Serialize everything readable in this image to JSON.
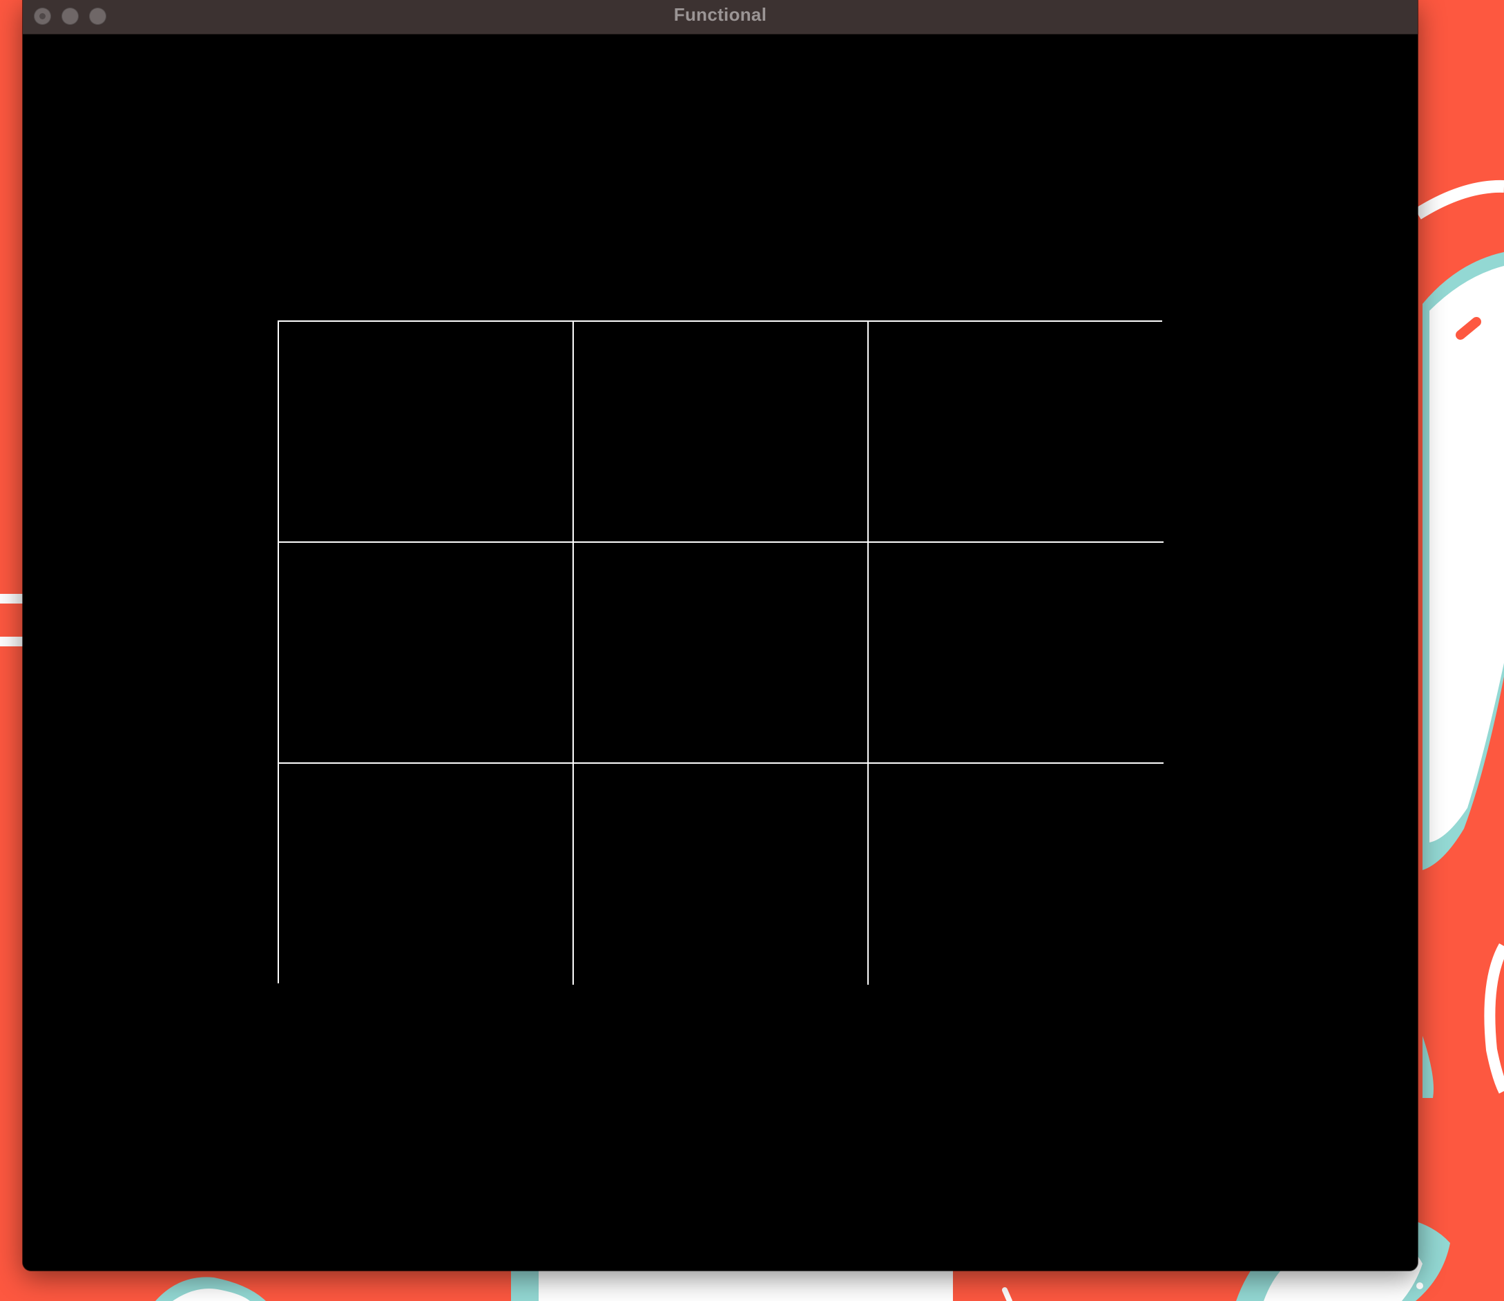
{
  "window": {
    "title": "Functional"
  },
  "board": {
    "rows": 3,
    "columns": 3,
    "cells": [
      "",
      "",
      "",
      "",
      "",
      "",
      "",
      "",
      ""
    ]
  },
  "colors": {
    "desktop_background": "#fd5840",
    "wallpaper_teal": "#93d8d3",
    "wallpaper_white": "#ffffff",
    "titlebar": "#3c3231",
    "content_background": "#000000",
    "grid_lines": "#ffffff"
  }
}
